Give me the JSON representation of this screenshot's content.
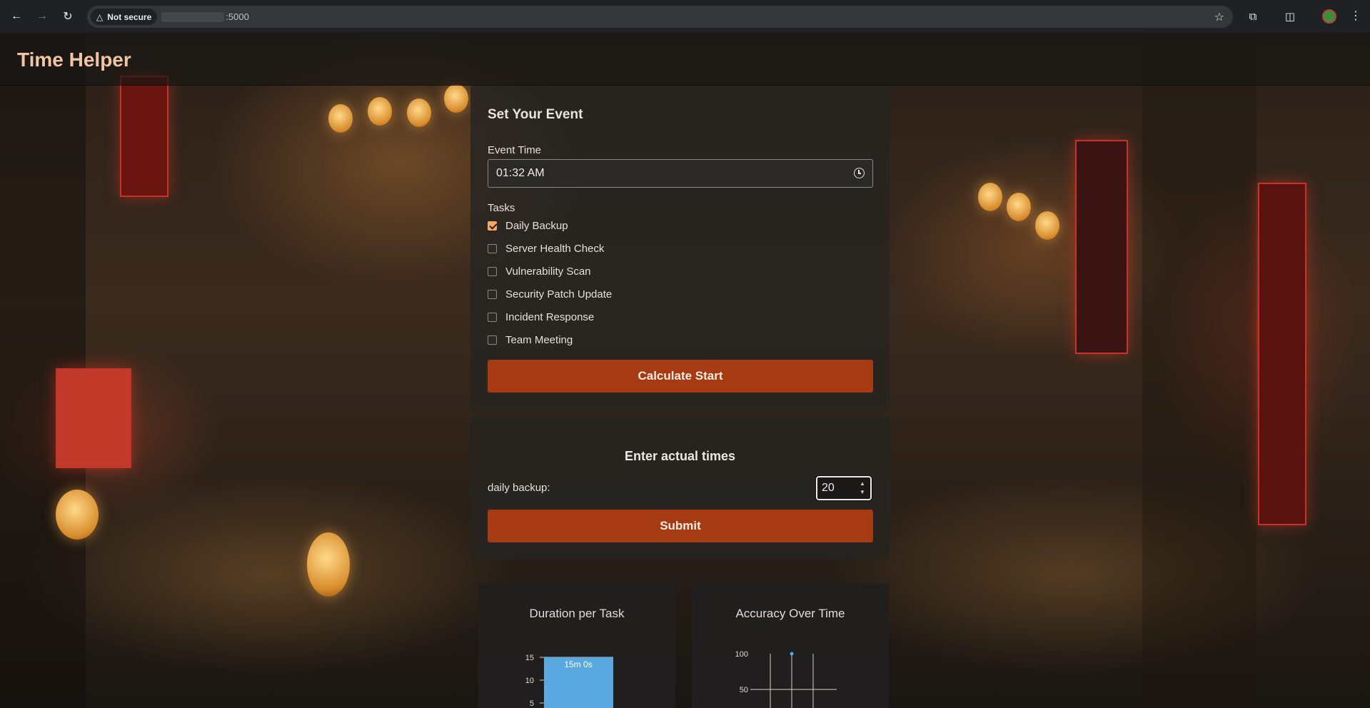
{
  "browser": {
    "security_label": "Not secure",
    "url_suffix": ":5000"
  },
  "app": {
    "title": "Time Helper"
  },
  "event_form": {
    "heading": "Set Your Event",
    "event_time_label": "Event Time",
    "event_time_value": "01:32 AM",
    "tasks_label": "Tasks",
    "tasks": [
      {
        "label": "Daily Backup",
        "checked": true
      },
      {
        "label": "Server Health Check",
        "checked": false
      },
      {
        "label": "Vulnerability Scan",
        "checked": false
      },
      {
        "label": "Security Patch Update",
        "checked": false
      },
      {
        "label": "Incident Response",
        "checked": false
      },
      {
        "label": "Team Meeting",
        "checked": false
      }
    ],
    "calculate_label": "Calculate Start"
  },
  "actual_times": {
    "heading": "Enter actual times",
    "rows": [
      {
        "label": "daily backup:",
        "value": "20"
      }
    ],
    "submit_label": "Submit"
  },
  "charts": {
    "duration": {
      "title": "Duration per Task"
    },
    "accuracy": {
      "title": "Accuracy Over Time"
    }
  },
  "chart_data": [
    {
      "type": "bar",
      "title": "Duration per Task",
      "categories": [
        ""
      ],
      "values": [
        15
      ],
      "data_labels": [
        "15m 0s"
      ],
      "yticks": [
        5,
        10,
        15
      ],
      "ylim_visible": [
        5,
        15
      ],
      "color": "#5aa8e0"
    },
    {
      "type": "line",
      "title": "Accuracy Over Time",
      "yticks": [
        50,
        100
      ],
      "series": [
        {
          "values": [
            100
          ]
        }
      ],
      "color": "#5aa8e0"
    }
  ]
}
